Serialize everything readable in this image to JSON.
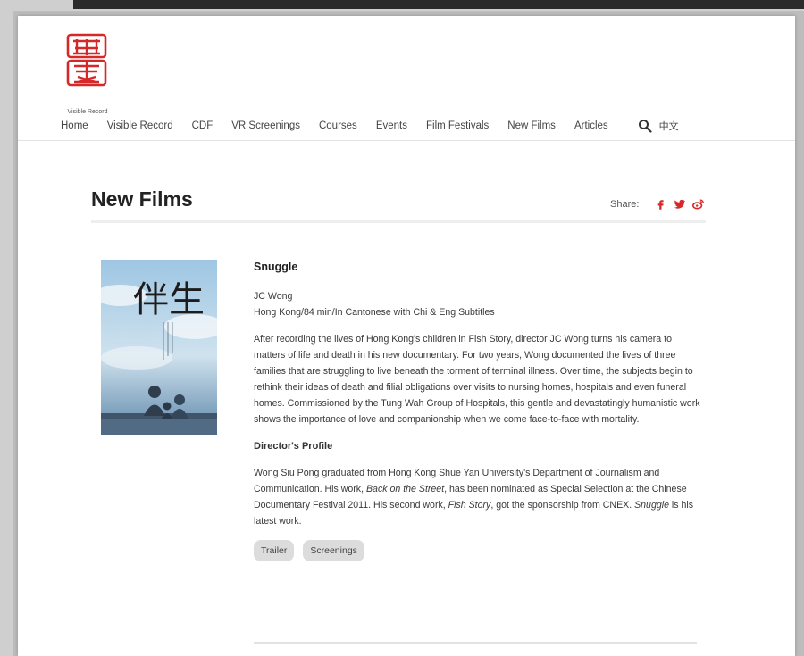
{
  "site": {
    "logo_caption": "Visible Record"
  },
  "nav": {
    "items": [
      "Home",
      "Visible Record",
      "CDF",
      "VR Screenings",
      "Courses",
      "Events",
      "Film Festivals",
      "New Films",
      "Articles"
    ],
    "search_icon": "search-icon",
    "language": "中文"
  },
  "page": {
    "title": "New Films",
    "share_label": "Share:",
    "share_icons": [
      "facebook-icon",
      "twitter-icon",
      "weibo-icon"
    ]
  },
  "film": {
    "title": "Snuggle",
    "director": "JC Wong",
    "details": "Hong Kong/84 min/In Cantonese with Chi & Eng Subtitles",
    "synopsis": "After recording the lives of Hong Kong's children in Fish Story, director JC Wong turns his camera to matters of life and death in his new documentary. For two years, Wong documented the lives of three families that are struggling to live beneath the torment of terminal illness. Over time, the subjects begin to rethink their ideas of death and filial obligations over visits to nursing homes, hospitals and even funeral homes. Commissioned by the Tung Wah Group of Hospitals, this gentle and devastatingly humanistic work shows the importance of love and companionship when we come face-to-face with mortality.",
    "profile_heading": "Director's Profile",
    "profile": {
      "p1": "Wong Siu Pong graduated from Hong Kong Shue Yan University's Department of Journalism and Communication. His work, ",
      "w1": "Back on the Street",
      "p2": ", has been nominated as Special Selection at the Chinese Documentary Festival 2011. His second work, ",
      "w2": "Fish Story",
      "p3": ", got the sponsorship from CNEX. ",
      "w3": "Snuggle",
      "p4": " is his latest work."
    },
    "buttons": {
      "trailer": "Trailer",
      "screenings": "Screenings"
    },
    "poster_title": "伴生"
  },
  "colors": {
    "accent": "#d62828",
    "text": "#3a3a3a"
  }
}
